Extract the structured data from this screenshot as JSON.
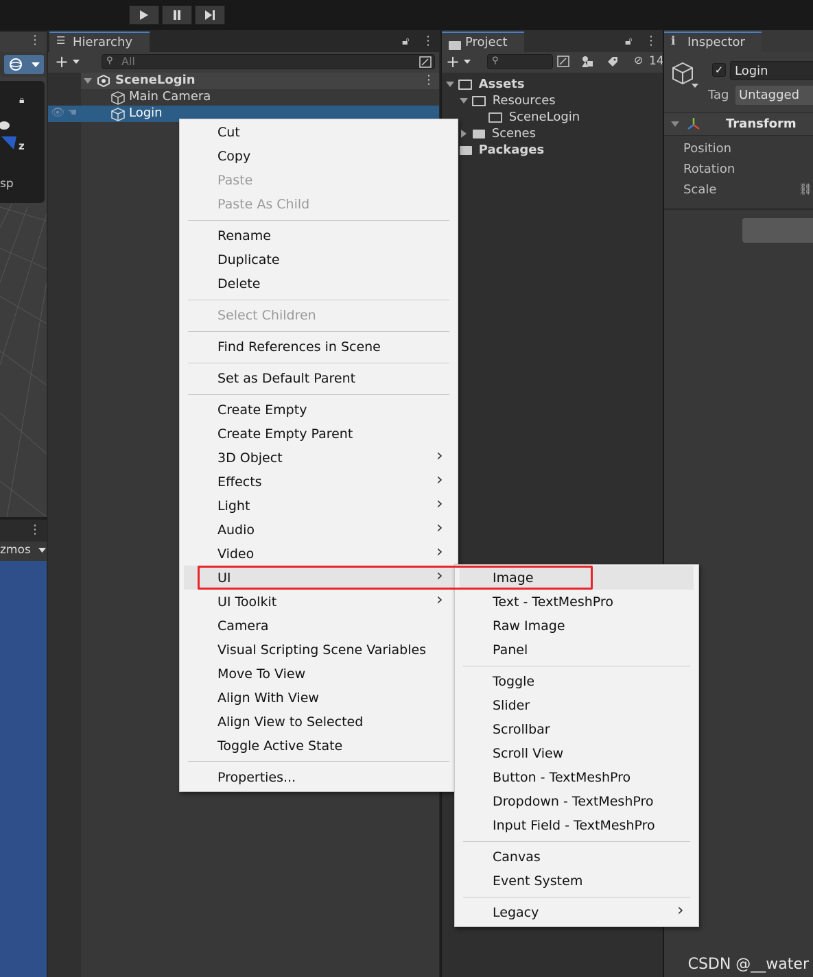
{
  "hierarchy": {
    "tab_label": "Hierarchy",
    "search_placeholder": "All",
    "scene_name": "SceneLogin",
    "items": [
      {
        "label": "Main Camera"
      },
      {
        "label": "Login"
      }
    ]
  },
  "project": {
    "tab_label": "Project",
    "hidden_count": "14",
    "tree": {
      "assets": "Assets",
      "resources": "Resources",
      "scene_login": "SceneLogin",
      "scenes": "Scenes",
      "packages": "Packages"
    }
  },
  "inspector": {
    "tab_label": "Inspector",
    "object_name": "Login",
    "tag_label": "Tag",
    "tag_value": "Untagged",
    "component": "Transform",
    "fields": [
      "Position",
      "Rotation",
      "Scale"
    ]
  },
  "scene_view": {
    "axis_label": "z",
    "persp_fragment": "sp",
    "gizmos_fragment": "zmos"
  },
  "context_menu": {
    "items": [
      {
        "label": "Cut"
      },
      {
        "label": "Copy"
      },
      {
        "label": "Paste",
        "disabled": true
      },
      {
        "label": "Paste As Child",
        "disabled": true
      },
      {
        "label": "Rename"
      },
      {
        "label": "Duplicate"
      },
      {
        "label": "Delete"
      },
      {
        "label": "Select Children",
        "disabled": true
      },
      {
        "label": "Find References in Scene"
      },
      {
        "label": "Set as Default Parent"
      },
      {
        "label": "Create Empty"
      },
      {
        "label": "Create Empty Parent"
      },
      {
        "label": "3D Object",
        "submenu": true
      },
      {
        "label": "Effects",
        "submenu": true
      },
      {
        "label": "Light",
        "submenu": true
      },
      {
        "label": "Audio",
        "submenu": true
      },
      {
        "label": "Video",
        "submenu": true
      },
      {
        "label": "UI",
        "submenu": true,
        "highlighted": true
      },
      {
        "label": "UI Toolkit",
        "submenu": true
      },
      {
        "label": "Camera"
      },
      {
        "label": "Visual Scripting Scene Variables"
      },
      {
        "label": "Move To View"
      },
      {
        "label": "Align With View"
      },
      {
        "label": "Align View to Selected"
      },
      {
        "label": "Toggle Active State"
      },
      {
        "label": "Properties..."
      }
    ]
  },
  "ui_submenu": {
    "items": [
      {
        "label": "Image",
        "highlighted": true
      },
      {
        "label": "Text - TextMeshPro"
      },
      {
        "label": "Raw Image"
      },
      {
        "label": "Panel"
      },
      {
        "label": "Toggle"
      },
      {
        "label": "Slider"
      },
      {
        "label": "Scrollbar"
      },
      {
        "label": "Scroll View"
      },
      {
        "label": "Button - TextMeshPro"
      },
      {
        "label": "Dropdown - TextMeshPro"
      },
      {
        "label": "Input Field - TextMeshPro"
      },
      {
        "label": "Canvas"
      },
      {
        "label": "Event System"
      },
      {
        "label": "Legacy",
        "submenu": true
      }
    ]
  },
  "watermark": "CSDN @__water",
  "colors": {
    "highlight_box": "#e8252a",
    "selection": "#2c5d87",
    "tab_accent": "#4a7fc8"
  }
}
